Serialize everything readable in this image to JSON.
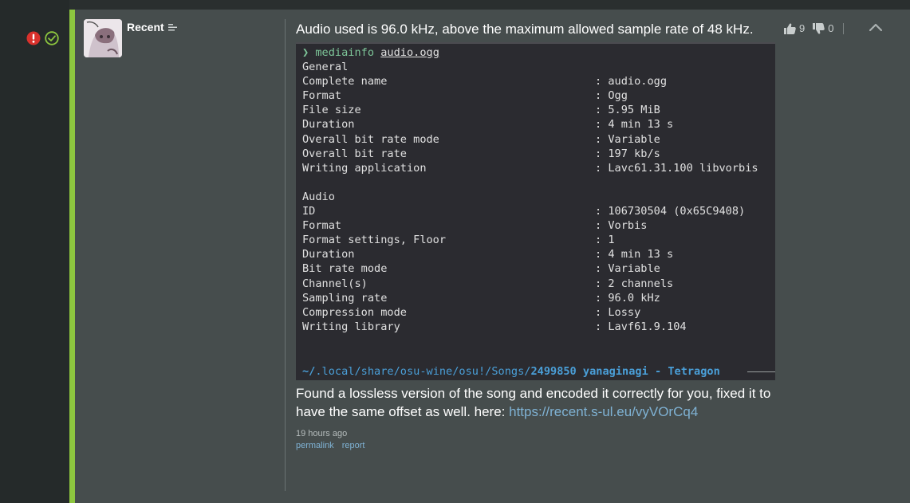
{
  "post": {
    "author": "Recent",
    "message1": "Audio used is 96.0 kHz, above the maximum allowed sample rate of 48 kHz.",
    "message2_prefix": "Found a lossless version of the song and encoded it correctly for you, fixed it to have the same offset as well. here: ",
    "link_text": "https://recent.s-ul.eu/vyVOrCq4",
    "timestamp": "19 hours ago",
    "actions": [
      "permalink",
      "report"
    ],
    "upvotes": "9",
    "downvotes": "0"
  },
  "terminal": {
    "prompt": "❯",
    "command": "mediainfo",
    "argument": "audio.ogg",
    "lines": [
      {
        "label": "General",
        "value": ""
      },
      {
        "label": "Complete name",
        "value": ": audio.ogg"
      },
      {
        "label": "Format",
        "value": ": Ogg"
      },
      {
        "label": "File size",
        "value": ": 5.95 MiB"
      },
      {
        "label": "Duration",
        "value": ": 4 min 13 s"
      },
      {
        "label": "Overall bit rate mode",
        "value": ": Variable"
      },
      {
        "label": "Overall bit rate",
        "value": ": 197 kb/s"
      },
      {
        "label": "Writing application",
        "value": ": Lavc61.31.100 libvorbis"
      },
      {
        "label": "",
        "value": ""
      },
      {
        "label": "Audio",
        "value": ""
      },
      {
        "label": "ID",
        "value": ": 106730504 (0x65C9408)"
      },
      {
        "label": "Format",
        "value": ": Vorbis"
      },
      {
        "label": "Format settings, Floor",
        "value": ": 1"
      },
      {
        "label": "Duration",
        "value": ": 4 min 13 s"
      },
      {
        "label": "Bit rate mode",
        "value": ": Variable"
      },
      {
        "label": "Channel(s)",
        "value": ": 2 channels"
      },
      {
        "label": "Sampling rate",
        "value": ": 96.0 kHz"
      },
      {
        "label": "Compression mode",
        "value": ": Lossy"
      },
      {
        "label": "Writing library",
        "value": ": Lavf61.9.104"
      }
    ],
    "status_tilde": "~/",
    "status_path": ".local/share/osu-wine/osu!/Songs/",
    "status_folder": "2499850 yanaginagi - Tetragon"
  },
  "colors": {
    "accent": "#8dc63f",
    "issue": "#d9312c",
    "resolved": "#8dc63f",
    "link": "#7fb2d4"
  },
  "icons": [
    "issue-icon",
    "resolved-icon",
    "list-icon",
    "thumbs-up-icon",
    "thumbs-down-icon",
    "chevron-up-icon"
  ]
}
